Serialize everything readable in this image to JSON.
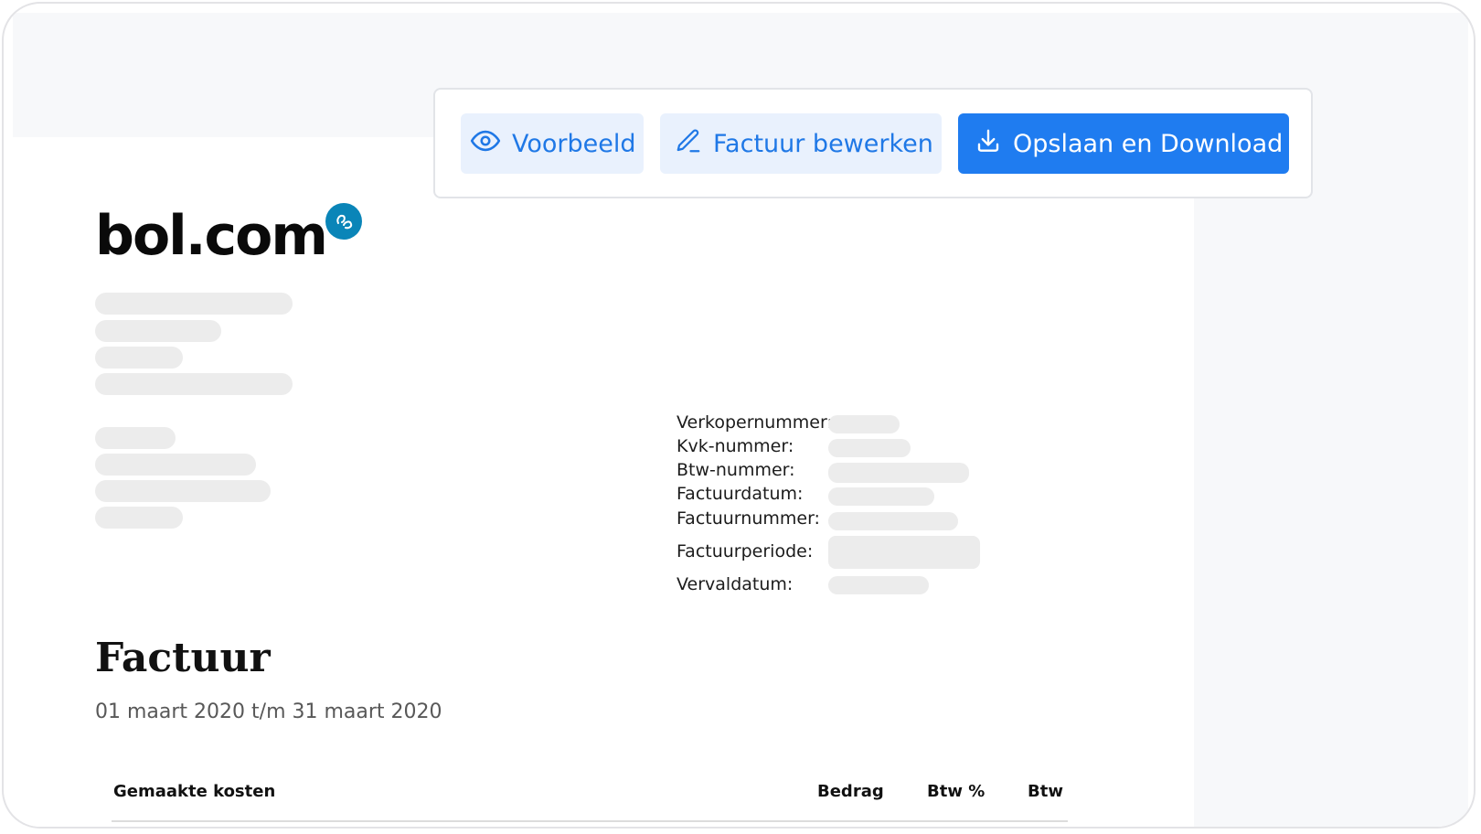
{
  "toolbar": {
    "preview_label": "Voorbeeld",
    "edit_label": "Factuur bewerken",
    "save_label": "Opslaan en Download",
    "accent_color": "#1f7cf0",
    "light_button_color": "#e9f1fd"
  },
  "brand": {
    "logo_text": "bol.com",
    "badge_color": "#0a85b8"
  },
  "details": {
    "labels": [
      "Verkopernummer:",
      "Kvk-nummer:",
      "Btw-nummer:",
      "Factuurdatum:",
      "Factuurnummer:",
      "Factuurperiode:",
      "Vervaldatum:"
    ]
  },
  "invoice": {
    "title": "Factuur",
    "period": "01 maart 2020 t/m 31 maart 2020"
  },
  "table": {
    "columns": [
      "Gemaakte kosten",
      "Bedrag",
      "Btw %",
      "Btw"
    ]
  }
}
